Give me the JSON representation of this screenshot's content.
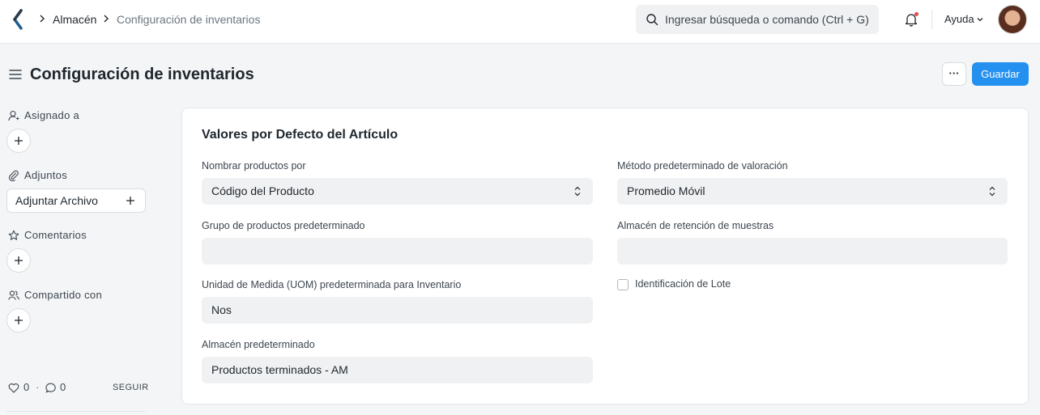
{
  "navbar": {
    "breadcrumbs": [
      "Almacén",
      "Configuración de inventarios"
    ],
    "search_placeholder": "Ingresar búsqueda o comando (Ctrl + G)",
    "help_label": "Ayuda",
    "icons": [
      "app-logo-icon",
      "search-icon",
      "bell-icon",
      "chevron-down-icon"
    ]
  },
  "page": {
    "title": "Configuración de inventarios",
    "more_label": "···",
    "save_label": "Guardar"
  },
  "sidebar": {
    "assigned_label": "Asignado a",
    "attachments_label": "Adjuntos",
    "attach_file_label": "Adjuntar Archivo",
    "comments_label": "Comentarios",
    "shared_label": "Compartido con",
    "likes_count": "0",
    "comments_count": "0",
    "separator": "·",
    "follow_label": "SEGUIR"
  },
  "form": {
    "section_title": "Valores por Defecto del Artículo",
    "fields": {
      "item_naming_by": {
        "label": "Nombrar productos por",
        "value": "Código del Producto",
        "type": "select"
      },
      "valuation_method": {
        "label": "Método predeterminado de valoración",
        "value": "Promedio Móvil",
        "type": "select"
      },
      "item_group": {
        "label": "Grupo de productos predeterminado",
        "value": ""
      },
      "sample_warehouse": {
        "label": "Almacén de retención de muestras",
        "value": ""
      },
      "stock_uom": {
        "label": "Unidad de Medida (UOM) predeterminada para Inventario",
        "value": "Nos"
      },
      "batch_id": {
        "label": "Identificación de Lote",
        "checked": false
      },
      "default_warehouse": {
        "label": "Almacén predeterminado",
        "value": "Productos terminados - AM"
      }
    }
  },
  "colors": {
    "primary": "#2490ef",
    "background": "#f4f5f6",
    "field_bg": "#f0f1f2",
    "text": "#1f272e"
  }
}
